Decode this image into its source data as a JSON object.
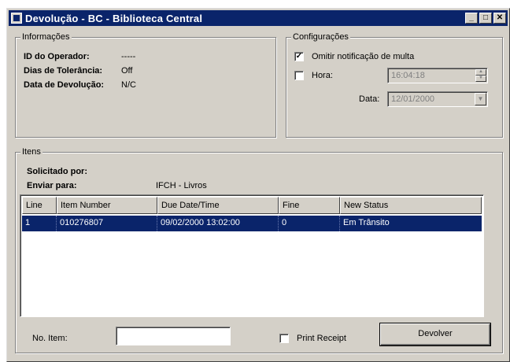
{
  "window": {
    "title": "Devolução - BC - Biblioteca Central",
    "min_glyph": "_",
    "max_glyph": "□",
    "close_glyph": "✕"
  },
  "informacoes": {
    "legend": "Informações",
    "operador_label": "ID do Operador:",
    "operador_value": "-----",
    "tolerancia_label": "Dias de Tolerância:",
    "tolerancia_value": "Off",
    "devolucao_label": "Data de Devolução:",
    "devolucao_value": "N/C"
  },
  "configuracoes": {
    "legend": "Configurações",
    "omitir_label": "Omitir notificação de multa",
    "omitir_checked": "✓",
    "hora_label": "Hora:",
    "hora_value": "16:04:18",
    "data_label": "Data:",
    "data_value": "12/01/2000"
  },
  "itens": {
    "legend": "Itens",
    "solicitado_label": "Solicitado por:",
    "solicitado_value": "",
    "enviar_label": "Enviar para:",
    "enviar_value": "IFCH - Livros",
    "columns": [
      "Line",
      "Item Number",
      "Due Date/Time",
      "Fine",
      "New Status"
    ],
    "rows": [
      [
        "1",
        "010276807",
        "09/02/2000 13:02:00",
        "0",
        "Em Trânsito"
      ]
    ]
  },
  "footer": {
    "no_item_label": "No. Item:",
    "no_item_value": "",
    "print_label": "Print Receipt",
    "devolver_label": "Devolver"
  },
  "colors": {
    "titlebar": "#0a246a",
    "face": "#d4d0c8",
    "selection": "#0a246a"
  }
}
